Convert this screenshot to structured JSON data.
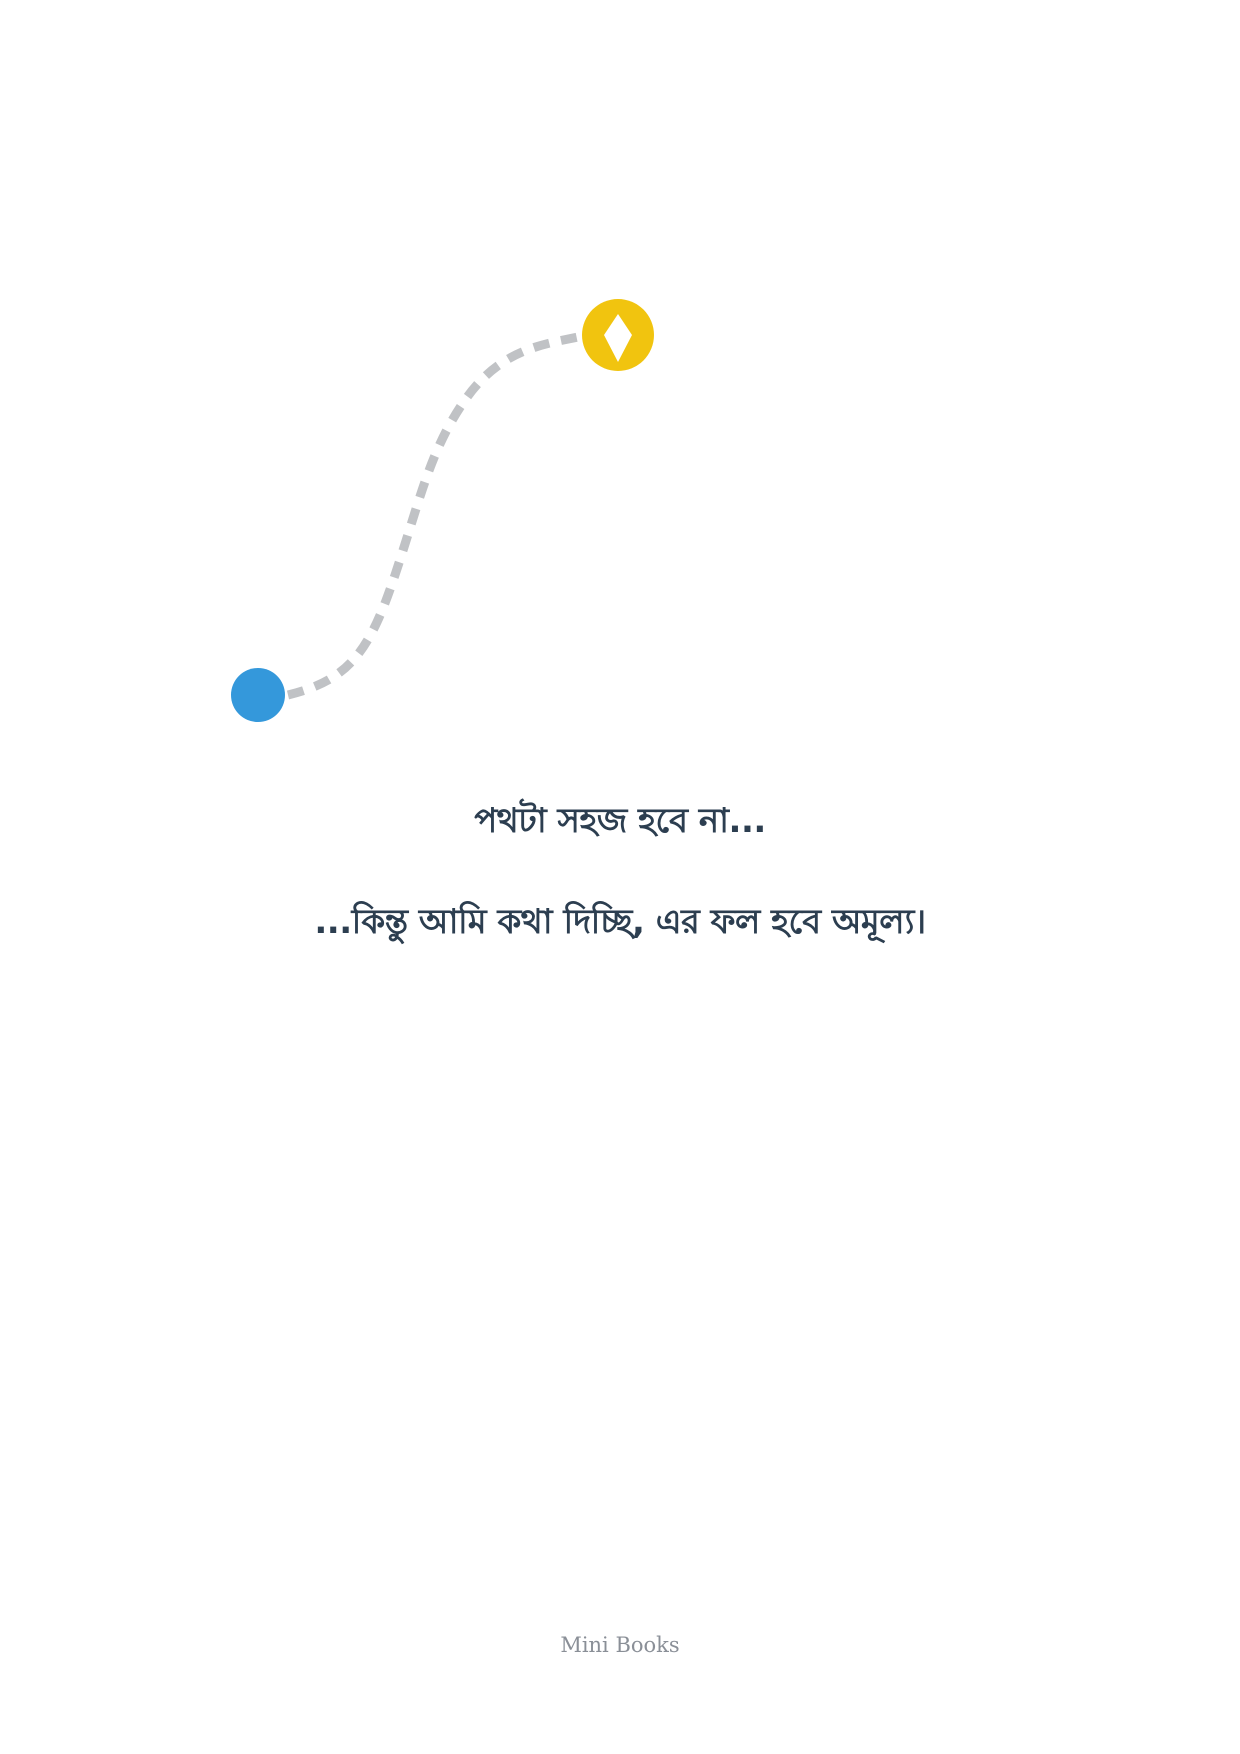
{
  "page": {
    "line1": "পথটা সহজ হবে না...",
    "line2": "...কিন্তু আমি কথা দিচ্ছি, এর ফল হবে অমূল্য।",
    "footer": "Mini Books"
  },
  "illustration": {
    "path_color": "#c0c2c5",
    "start_dot_color": "#3498db",
    "goal_dot_color": "#f1c40f",
    "goal_icon": "diamond-icon",
    "goal_icon_color": "#ffffff"
  },
  "colors": {
    "text": "#2c3e50",
    "footer_text": "#8a8f97",
    "background": "#ffffff"
  }
}
